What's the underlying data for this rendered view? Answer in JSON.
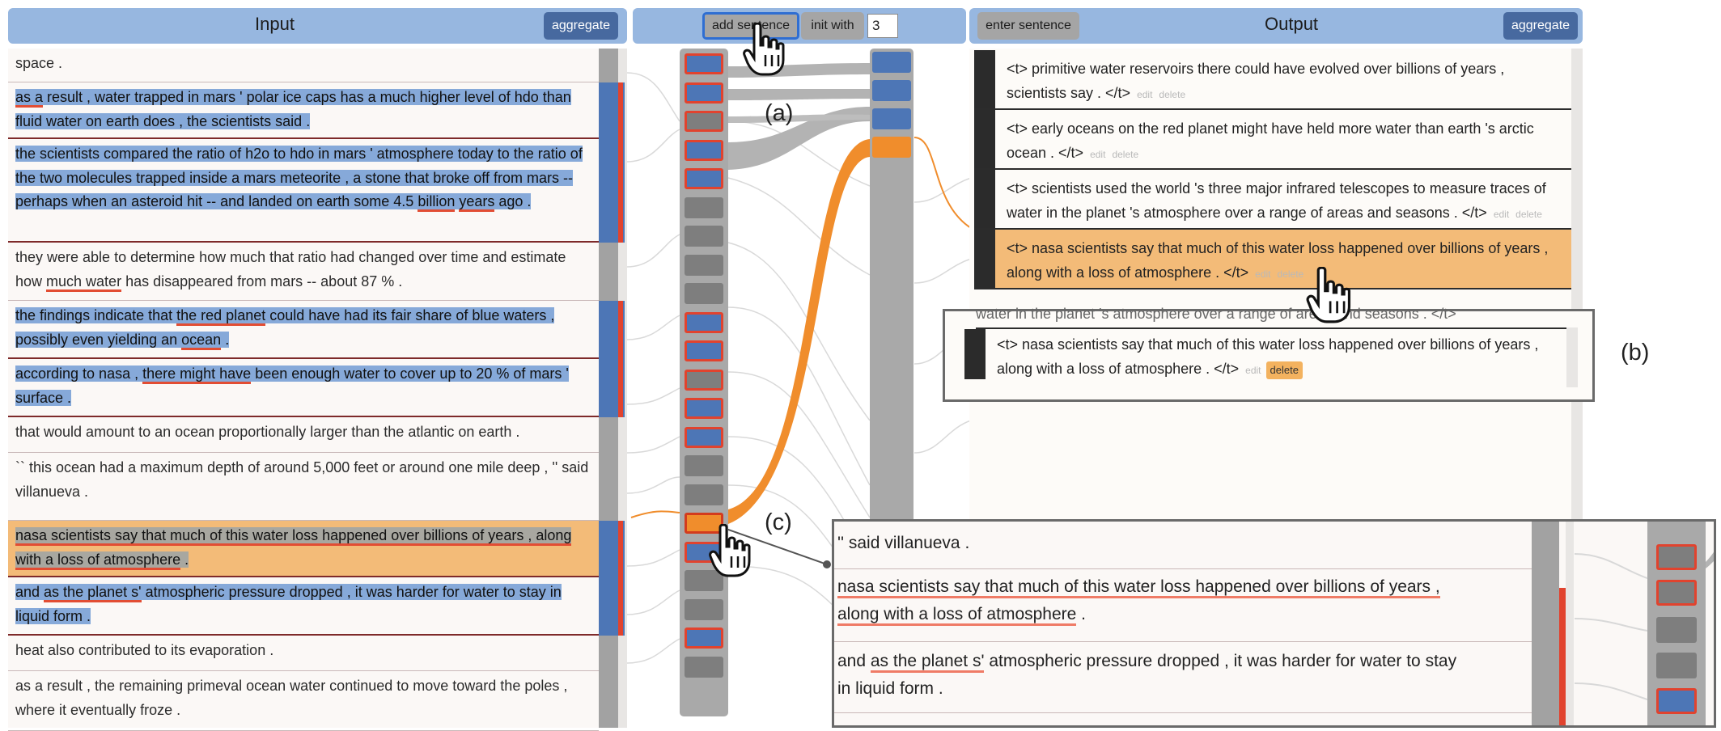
{
  "input_panel": {
    "title": "Input",
    "aggregate_label": "aggregate",
    "sentences": [
      {
        "text": "space ."
      },
      {
        "segments": [
          {
            "t": "as a",
            "ul": true
          },
          {
            "t": " result , water trapped in mars ' polar ice caps has a much higher level of hdo than fluid water on earth does , the scientists said ."
          }
        ]
      },
      {
        "segments": [
          {
            "t": "the scientists compared the ratio of h2o to hdo in mars ' atmosphere today to the ratio of the two molecules trapped inside a mars meteorite , a stone that broke off from mars -- perhaps when an asteroid hit -- and landed on earth some 4.5 "
          },
          {
            "t": "billion",
            "ul": true
          },
          {
            "t": " "
          },
          {
            "t": "years",
            "ul": true
          },
          {
            "t": " ago ."
          }
        ]
      },
      {
        "segments": [
          {
            "t": "they were able to determine how much that ratio had changed over time and estimate how "
          },
          {
            "t": "much water",
            "ul": true
          },
          {
            "t": " has disappeared from mars -- about 87 % ."
          }
        ]
      },
      {
        "segments": [
          {
            "t": "the findings indicate that "
          },
          {
            "t": "the red planet",
            "ul": true
          },
          {
            "t": " could have had its fair share of blue waters , possibly even yielding an "
          },
          {
            "t": "ocean",
            "ul": true
          },
          {
            "t": " ."
          }
        ]
      },
      {
        "segments": [
          {
            "t": "according to nasa , "
          },
          {
            "t": "there might have",
            "ul": true
          },
          {
            "t": " been enough water to cover up to 20 % of mars ' surface ."
          }
        ]
      },
      {
        "text": "that would amount to an ocean proportionally larger than the atlantic on earth ."
      },
      {
        "text": "`` this ocean had a maximum depth of around 5,000 feet or around one mile deep , '' said villanueva ."
      },
      {
        "segments": [
          {
            "t": "nasa scientists say that much of this water loss happened over billions of years , along with a loss of atmosphere",
            "ul": true
          },
          {
            "t": " ."
          }
        ]
      },
      {
        "segments": [
          {
            "t": "and "
          },
          {
            "t": "as the planet s'",
            "ul": true
          },
          {
            "t": " atmospheric pressure dropped , it was harder for water to stay in liquid form ."
          }
        ]
      },
      {
        "text": "heat also contributed to its evaporation ."
      },
      {
        "text": "as a result , the remaining primeval ocean water continued to move toward the poles , where it eventually froze ."
      }
    ]
  },
  "middle": {
    "add_sentence_label": "add sentence",
    "init_with_label": "init with",
    "init_value": "3"
  },
  "output_panel": {
    "enter_sentence_label": "enter sentence",
    "title": "Output",
    "aggregate_label": "aggregate",
    "sentences": [
      {
        "text": "<t> primitive water reservoirs there could have evolved over billions of years , scientists say . </t>",
        "edit": "edit",
        "delete": "delete"
      },
      {
        "text": "<t> early oceans on the red planet might have held more water than earth 's arctic ocean . </t>",
        "edit": "edit",
        "delete": "delete"
      },
      {
        "text": "<t> scientists used the world 's three major infrared telescopes to measure traces of water in the planet 's atmosphere over a range of areas and seasons . </t>",
        "edit": "edit",
        "delete": "delete"
      },
      {
        "text": "<t> nasa scientists say that much of this water loss happened over billions of years , along with a loss of atmosphere . </t>",
        "edit": "edit",
        "delete": "delete"
      }
    ],
    "drag_preview": {
      "peek_text": "water in the planet 's atmosphere over a range of areas and seasons . </t>",
      "text": "<t> nasa scientists say that much of this water loss happened over billions of years , along with a loss of atmosphere . </t>",
      "edit": "edit",
      "delete": "delete"
    }
  },
  "zoom": {
    "line0": "'' said villanueva .",
    "line1a": "nasa scientists say that much of this water loss happened over billions of years ,",
    "line1b": "along with a loss of atmosphere",
    "line1c": " .",
    "line2a": "and ",
    "line2b": "as the planet s'",
    "line2c": " atmospheric pressure dropped , it was harder for water to stay",
    "line2d": "in liquid form ."
  },
  "labels": {
    "a": "(a)",
    "b": "(b)",
    "c": "(c)"
  },
  "colors": {
    "header": "#97b7e0",
    "highlight_blue": "#86a9d9",
    "highlight_orange": "#f3bb78",
    "underline_red": "#e24d33",
    "button_dark": "#47699f",
    "flow_orange": "#f08d2c"
  }
}
